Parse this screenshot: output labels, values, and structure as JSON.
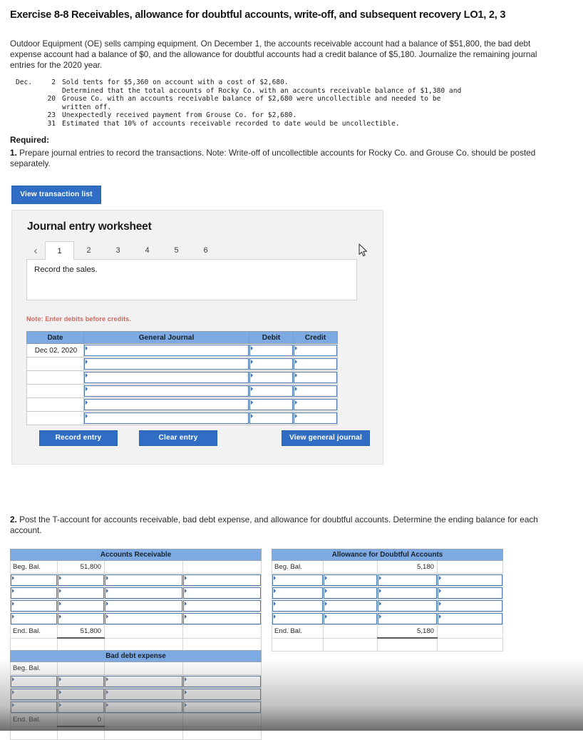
{
  "page": {
    "title": "Exercise 8-8 Receivables, allowance for doubtful accounts, write-off, and subsequent recovery LO1, 2, 3",
    "intro": "Outdoor Equipment (OE) sells camping equipment. On December 1, the accounts receivable account had a balance of $51,800, the bad debt expense account had a balance of $0, and the allowance for doubtful accounts had a credit balance of $5,180. Journalize the remaining journal entries for the 2020 year."
  },
  "transactions": {
    "rows": [
      {
        "month": "Dec.",
        "day": "2",
        "desc": "Sold tents for $5,360 on account with a cost of $2,680."
      },
      {
        "month": "",
        "day": "",
        "desc": "Determined that the total accounts of Rocky Co. with an accounts receivable balance of $1,380 and"
      },
      {
        "month": "",
        "day": "20",
        "desc": "Grouse Co. with an accounts receivable balance of $2,680 were uncollectible and needed to be"
      },
      {
        "month": "",
        "day": "",
        "desc": "written off."
      },
      {
        "month": "",
        "day": "23",
        "desc": "Unexpectedly received payment from Grouse Co. for $2,680."
      },
      {
        "month": "",
        "day": "31",
        "desc": "Estimated that 10% of accounts receivable recorded to date would be uncollectible."
      }
    ]
  },
  "required": {
    "heading": "Required:",
    "number": "1.",
    "text": " Prepare journal entries to record the transactions. Note: Write-off of uncollectible accounts for Rocky Co. and Grouse Co. should be posted separately."
  },
  "buttons": {
    "view_transaction_list": "View transaction list",
    "record_entry": "Record entry",
    "clear_entry": "Clear entry",
    "view_general_journal": "View general journal"
  },
  "worksheet": {
    "title": "Journal entry worksheet",
    "prev_glyph": "‹",
    "tabs": [
      "1",
      "2",
      "3",
      "4",
      "5",
      "6"
    ],
    "active_tab": "1",
    "instruction": "Record the sales.",
    "note": "Note: Enter debits before credits.",
    "table": {
      "headers": [
        "Date",
        "General Journal",
        "Debit",
        "Credit"
      ],
      "rows": [
        {
          "date": "Dec 02, 2020",
          "general_journal": "",
          "debit": "",
          "credit": ""
        },
        {
          "date": "",
          "general_journal": "",
          "debit": "",
          "credit": ""
        },
        {
          "date": "",
          "general_journal": "",
          "debit": "",
          "credit": ""
        },
        {
          "date": "",
          "general_journal": "",
          "debit": "",
          "credit": ""
        },
        {
          "date": "",
          "general_journal": "",
          "debit": "",
          "credit": ""
        },
        {
          "date": "",
          "general_journal": "",
          "debit": "",
          "credit": ""
        }
      ]
    }
  },
  "part2": {
    "number": "2.",
    "text": " Post the T-account for accounts receivable, bad debt expense, and allowance for doubtful accounts. Determine the ending balance for each account."
  },
  "taccounts": {
    "accounts_receivable": {
      "title": "Accounts Receivable",
      "beg_label": "Beg. Bal.",
      "beg_debit": "51,800",
      "beg_credit": "",
      "entry_rows": 4,
      "end_label": "End. Bal.",
      "end_debit": "51,800",
      "end_credit": ""
    },
    "allowance_doubtful": {
      "title": "Allowance for Doubtful Accounts",
      "beg_label": "Beg. Bal.",
      "beg_debit": "",
      "beg_credit": "5,180",
      "entry_rows": 4,
      "end_label": "End. Bal.",
      "end_debit": "",
      "end_credit": "5,180"
    },
    "bad_debt_expense": {
      "title": "Bad debt expense",
      "beg_label": "Beg. Bal.",
      "beg_debit": "",
      "beg_credit": "",
      "entry_rows": 3,
      "end_label": "End. Bal.",
      "end_debit": "0",
      "end_credit": ""
    }
  },
  "colors": {
    "button_blue": "#2f6ec4",
    "table_header_blue": "#7daae2",
    "note_red": "#cc6a63",
    "panel_gray": "#f2f2f2",
    "cell_border_blue": "#4d78ad"
  }
}
